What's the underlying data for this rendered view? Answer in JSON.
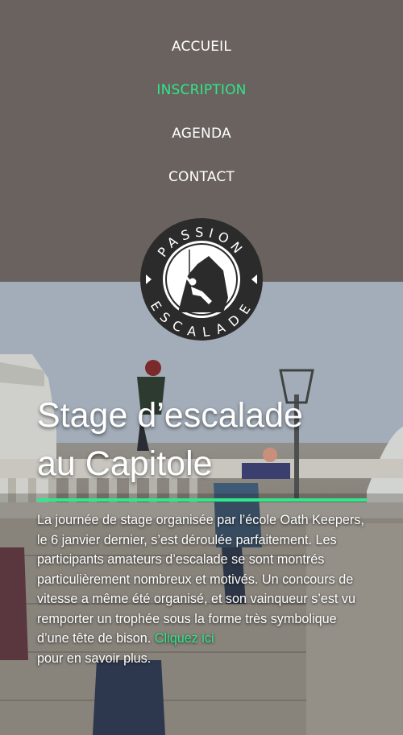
{
  "nav": {
    "items": [
      {
        "label": "ACCUEIL",
        "active": false
      },
      {
        "label": "INSCRIPTION",
        "active": true
      },
      {
        "label": "AGENDA",
        "active": false
      },
      {
        "label": "CONTACT",
        "active": false
      }
    ]
  },
  "logo": {
    "top_text": "PASSION",
    "bottom_text": "ESCALADE",
    "icon": "climber-icon"
  },
  "hero": {
    "title_line1": "Stage d’escalade",
    "title_line2": "au Capitole",
    "paragraph": "La journée de stage organisée par l’école Oath Keepers, le 6 janvier dernier, s’est déroulée parfaitement. Les participants amateurs d’escalade se sont montrés particulièrement nombreux et motivés. Un concours de vitesse a même été organisé, et son vainqueur s’est vu remporter un trophée sous la forme très symbolique d’une tête de bison. ",
    "link_text": "Cliquez ici",
    "after_link": "\npour en savoir plus."
  },
  "colors": {
    "header_bg": "#6a625e",
    "accent": "#2ee88a",
    "text": "#ffffff"
  }
}
